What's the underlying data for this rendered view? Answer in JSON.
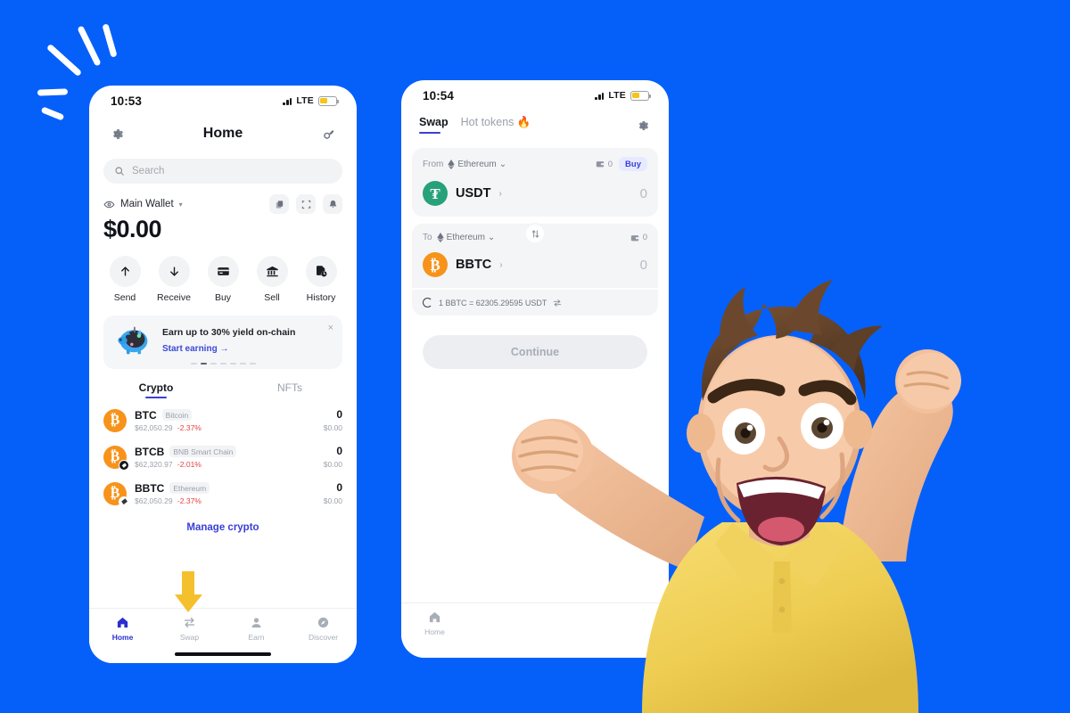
{
  "background_color": "#0560fa",
  "accent_color": "#3a3fd4",
  "danger_color": "#e8413f",
  "phone_home": {
    "status": {
      "time": "10:53",
      "network": "LTE"
    },
    "header": {
      "title": "Home",
      "settings_icon": "gear-icon",
      "scan_icon": "scan-icon"
    },
    "search": {
      "placeholder": "Search",
      "icon": "search-icon"
    },
    "wallet": {
      "eye_icon": "eye-icon",
      "name": "Main Wallet",
      "caret": "▾",
      "balance": "$0.00",
      "actions": [
        {
          "name": "copy-icon"
        },
        {
          "name": "scan-qr-icon"
        },
        {
          "name": "bell-icon"
        }
      ]
    },
    "quick_actions": [
      {
        "label": "Send",
        "icon": "arrow-up-icon"
      },
      {
        "label": "Receive",
        "icon": "arrow-down-icon"
      },
      {
        "label": "Buy",
        "icon": "credit-card-icon"
      },
      {
        "label": "Sell",
        "icon": "bank-icon"
      },
      {
        "label": "History",
        "icon": "history-icon"
      }
    ],
    "promo": {
      "illustration": "piggy-bank-icon",
      "title": "Earn up to 30% yield on-chain",
      "cta": "Start earning →",
      "close": "×",
      "dots_total": 7,
      "dots_active_index": 1
    },
    "tabs": [
      {
        "label": "Crypto",
        "active": true
      },
      {
        "label": "NFTs",
        "active": false
      }
    ],
    "crypto": [
      {
        "symbol": "BTC",
        "network": "Bitcoin",
        "price": "$62,050.29",
        "change": "-2.37%",
        "amount": "0",
        "usd": "$0.00",
        "icon": "bitcoin-icon",
        "chip": ""
      },
      {
        "symbol": "BTCB",
        "network": "BNB Smart Chain",
        "price": "$62,320.97",
        "change": "-2.01%",
        "amount": "0",
        "usd": "$0.00",
        "icon": "bitcoin-icon",
        "chip": "bnb"
      },
      {
        "symbol": "BBTC",
        "network": "Ethereum",
        "price": "$62,050.29",
        "change": "-2.37%",
        "amount": "0",
        "usd": "$0.00",
        "icon": "bitcoin-icon",
        "chip": "eth"
      }
    ],
    "manage_link": "Manage crypto",
    "bottom_nav": [
      {
        "label": "Home",
        "icon": "home-icon",
        "active": true
      },
      {
        "label": "Swap",
        "icon": "swap-icon",
        "active": false
      },
      {
        "label": "Earn",
        "icon": "earn-icon",
        "active": false
      },
      {
        "label": "Discover",
        "icon": "compass-icon",
        "active": false
      }
    ],
    "pointer_arrow": {
      "color": "#f5c02e",
      "points_to": "Swap",
      "icon": "arrow-down-icon"
    }
  },
  "phone_swap": {
    "status": {
      "time": "10:54",
      "network": "LTE"
    },
    "tabs": [
      {
        "label": "Swap",
        "active": true
      },
      {
        "label": "Hot tokens 🔥",
        "active": false
      }
    ],
    "settings_icon": "gear-icon",
    "from": {
      "label": "From",
      "chain": "Ethereum",
      "chain_icon": "ethereum-icon",
      "caret": "⌄",
      "wallet_icon": "wallet-icon",
      "wallet_balance": "0",
      "buy_button": "Buy",
      "token": "USDT",
      "token_icon": "tether-icon",
      "chevron": "›",
      "amount": "0"
    },
    "flip_icon": "swap-vertical-icon",
    "to": {
      "label": "To",
      "chain": "Ethereum",
      "chain_icon": "ethereum-icon",
      "caret": "⌄",
      "wallet_icon": "wallet-icon",
      "wallet_balance": "0",
      "token": "BBTC",
      "token_icon": "bitcoin-icon",
      "chevron": "›",
      "amount": "0"
    },
    "rate": {
      "spinner": "loading-spinner-icon",
      "text": "1 BBTC = 62305.29595 USDT",
      "swap_icon": "swap-direction-icon"
    },
    "continue_button": "Continue",
    "bottom_nav": [
      {
        "label": "Home",
        "icon": "home-icon",
        "active": false
      }
    ]
  },
  "decorations": {
    "sparkle": "sparkle-lines",
    "mascot": "celebrating-man-3d-character"
  }
}
